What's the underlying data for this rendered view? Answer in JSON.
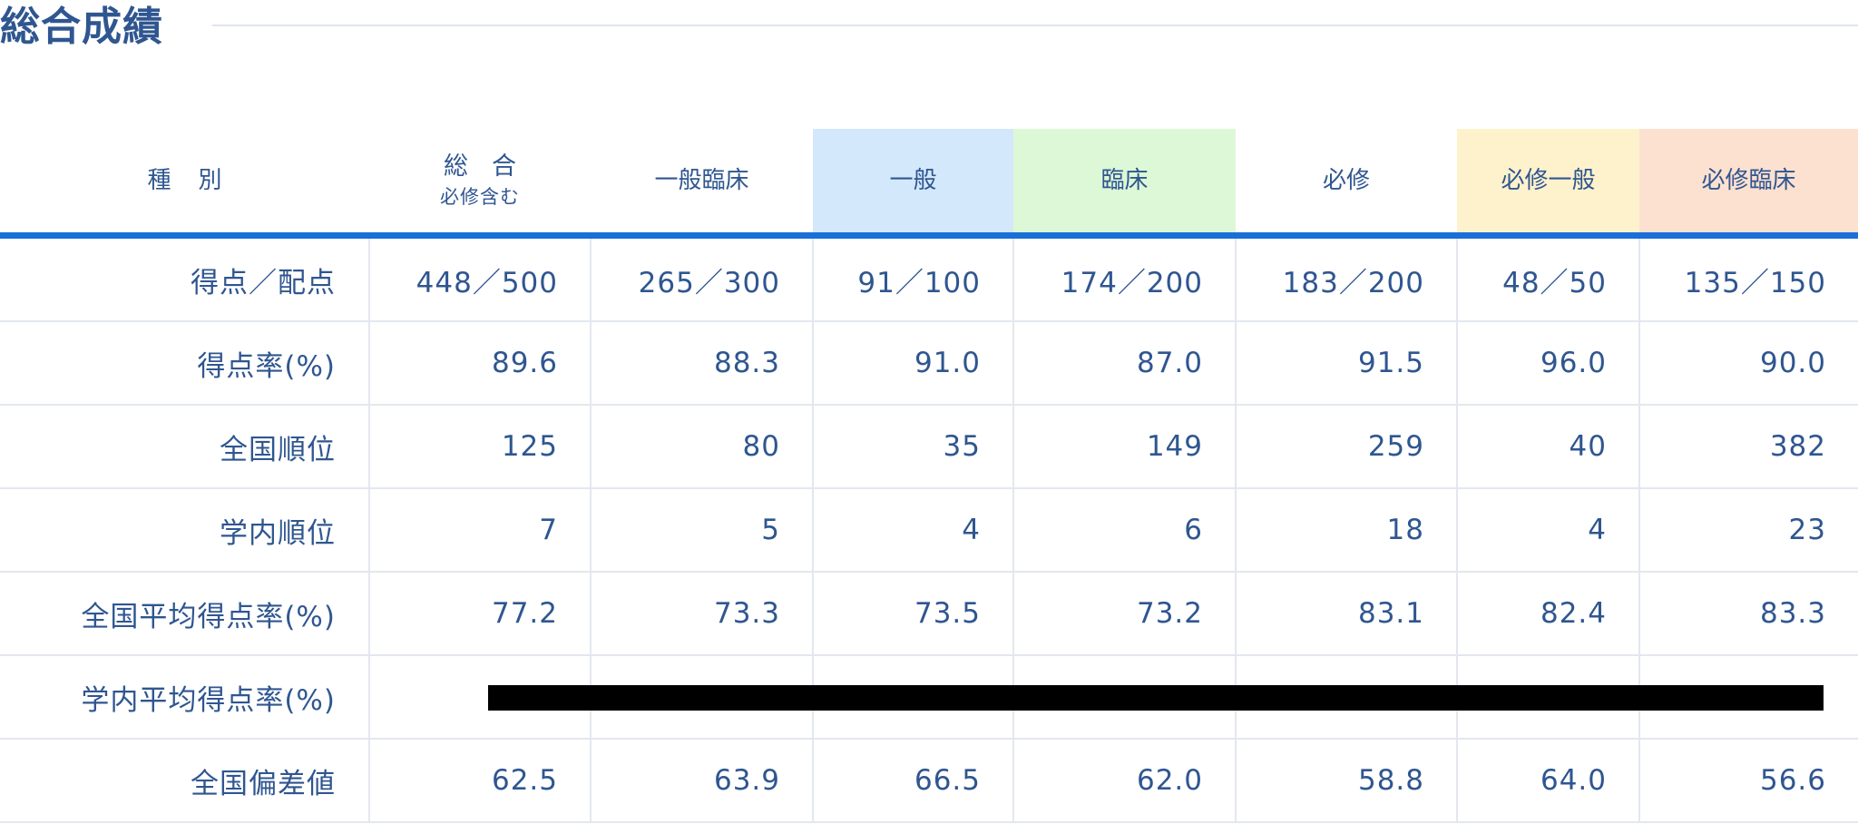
{
  "page": {
    "title": "総合成績"
  },
  "table": {
    "headers": [
      {
        "label": "種別",
        "sub": ""
      },
      {
        "label": "総合",
        "sub": "必修含む"
      },
      {
        "label": "一般臨床",
        "sub": ""
      },
      {
        "label": "一般",
        "sub": ""
      },
      {
        "label": "臨床",
        "sub": ""
      },
      {
        "label": "必修",
        "sub": ""
      },
      {
        "label": "必修一般",
        "sub": ""
      },
      {
        "label": "必修臨床",
        "sub": ""
      }
    ],
    "header_colors": {
      "一般": "#d4e8fc",
      "臨床": "#ddf8d6",
      "必修一般": "#fef2cc",
      "必修臨床": "#fde1d0"
    },
    "accent_color": "#1a6fd9",
    "rows": [
      {
        "label": "得点／配点",
        "values": [
          "448／500",
          "265／300",
          "91／100",
          "174／200",
          "183／200",
          "48／50",
          "135／150"
        ]
      },
      {
        "label": "得点率(%)",
        "values": [
          "89.6",
          "88.3",
          "91.0",
          "87.0",
          "91.5",
          "96.0",
          "90.0"
        ]
      },
      {
        "label": "全国順位",
        "values": [
          "125",
          "80",
          "35",
          "149",
          "259",
          "40",
          "382"
        ]
      },
      {
        "label": "学内順位",
        "values": [
          "7",
          "5",
          "4",
          "6",
          "18",
          "4",
          "23"
        ]
      },
      {
        "label": "全国平均得点率(%)",
        "values": [
          "77.2",
          "73.3",
          "73.5",
          "73.2",
          "83.1",
          "82.4",
          "83.3"
        ]
      },
      {
        "label": "学内平均得点率(%)",
        "values": [
          "",
          "",
          "",
          "",
          "",
          "",
          ""
        ]
      },
      {
        "label": "全国偏差値",
        "values": [
          "62.5",
          "63.9",
          "66.5",
          "62.0",
          "58.8",
          "64.0",
          "56.6"
        ]
      }
    ]
  }
}
